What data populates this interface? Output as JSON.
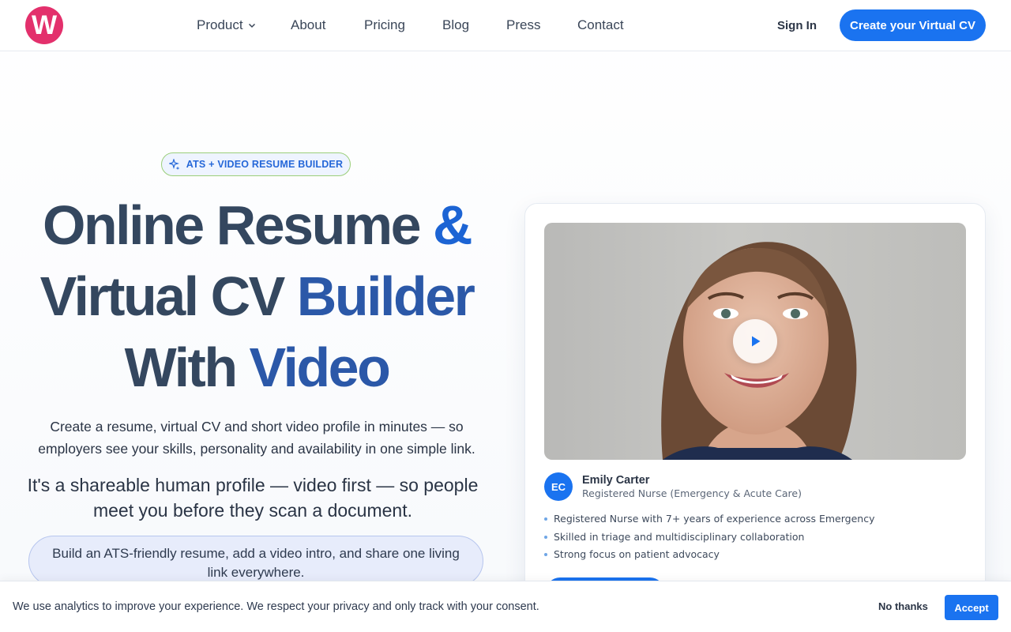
{
  "header": {
    "logo_letter": "W",
    "nav": [
      {
        "label": "Product",
        "has_dropdown": true
      },
      {
        "label": "About"
      },
      {
        "label": "Pricing"
      },
      {
        "label": "Blog"
      },
      {
        "label": "Press"
      },
      {
        "label": "Contact"
      }
    ],
    "sign_in": "Sign In",
    "cta": "Create your Virtual CV"
  },
  "hero": {
    "badge": "ATS + VIDEO RESUME BUILDER",
    "headline": {
      "line1_main": "Online Resume",
      "line1_accent": "&",
      "line2_main": "Virtual CV",
      "line2_accent": "Builder",
      "line3_main": "With",
      "line3_accent": "Video"
    },
    "subtitle": "Create a resume, virtual CV and short video profile in minutes — so employers see your skills, personality and availability in one simple link.",
    "tagline": "It's a shareable human profile — video first — so people meet you before they scan a document.",
    "pill": "Build an ATS-friendly resume, add a video intro, and share one living link everywhere."
  },
  "profile_card": {
    "initials": "EC",
    "name": "Emily Carter",
    "role": "Registered Nurse (Emergency & Acute Care)",
    "bullets": [
      "Registered Nurse with 7+ years of experience across Emergency",
      "Skilled in triage and multidisciplinary collaboration",
      "Strong focus on patient advocacy"
    ]
  },
  "cookie": {
    "text": "We use analytics to improve your experience. We respect your privacy and only track with your consent.",
    "decline": "No thanks",
    "accept": "Accept"
  },
  "colors": {
    "primary": "#1a73f0",
    "logo": "#e3306c",
    "heading": "#34475f"
  }
}
